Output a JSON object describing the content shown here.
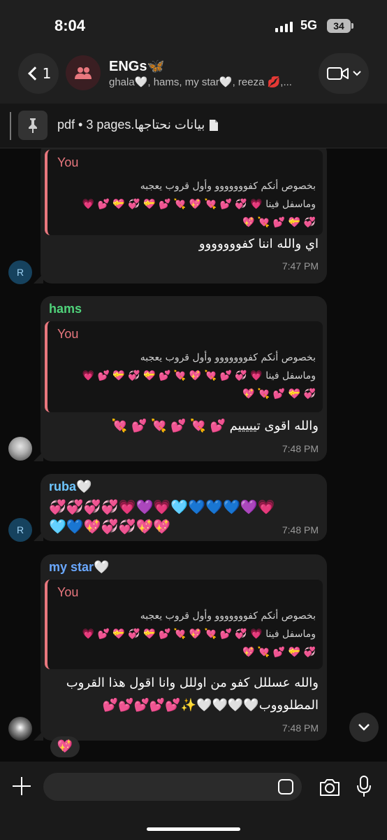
{
  "status": {
    "time": "8:04",
    "network": "5G",
    "battery": "34"
  },
  "header": {
    "back_count": "1",
    "title": "ENGs🦋",
    "subtitle": "ghala🤍, hams, my star🤍, reeza 💋,..."
  },
  "pinned": {
    "text": "pdf • 3 pages.بيانات نحتاجها",
    "icon": "document-icon"
  },
  "quote": {
    "name": "You",
    "text_line1": "بخصوص أنكم كفووووووو وأول قروب يعجبه",
    "text_line2": "وماسفل فينا 💗 💞 💕 💘 💖 💘 💕 💝 💞 💝 💕 💗",
    "text_line3": "💞 💝 💕 💘 💖"
  },
  "messages": [
    {
      "sender": "",
      "text": "اي والله اننا كفووووووو",
      "time": "7:47 PM",
      "avatar": "R"
    },
    {
      "sender": "hams",
      "text": "والله اقوى تيييييم 💕 💘 💕 💘 💕 💘",
      "time": "7:48 PM"
    },
    {
      "sender": "ruba🤍",
      "line1": "💞💞💞💞💗💜💗🩵💙💙💙💜💗",
      "line2": "🩵💙💖💞💞💖💖",
      "time": "7:48 PM",
      "avatar": "R"
    },
    {
      "sender": "my star🤍",
      "line1": "والله عسللل كفو من اوللل وانا اقول هذا القروب",
      "line2": "المطلوووب🤍🤍🤍🤍✨💕💕💕💕💕",
      "time": "7:48 PM",
      "reaction": "💖"
    }
  ],
  "colors": {
    "hams": "#4fd27a",
    "ruba": "#6ec6ff",
    "mystar": "#6aa8ff",
    "quote": "#e8777e"
  }
}
